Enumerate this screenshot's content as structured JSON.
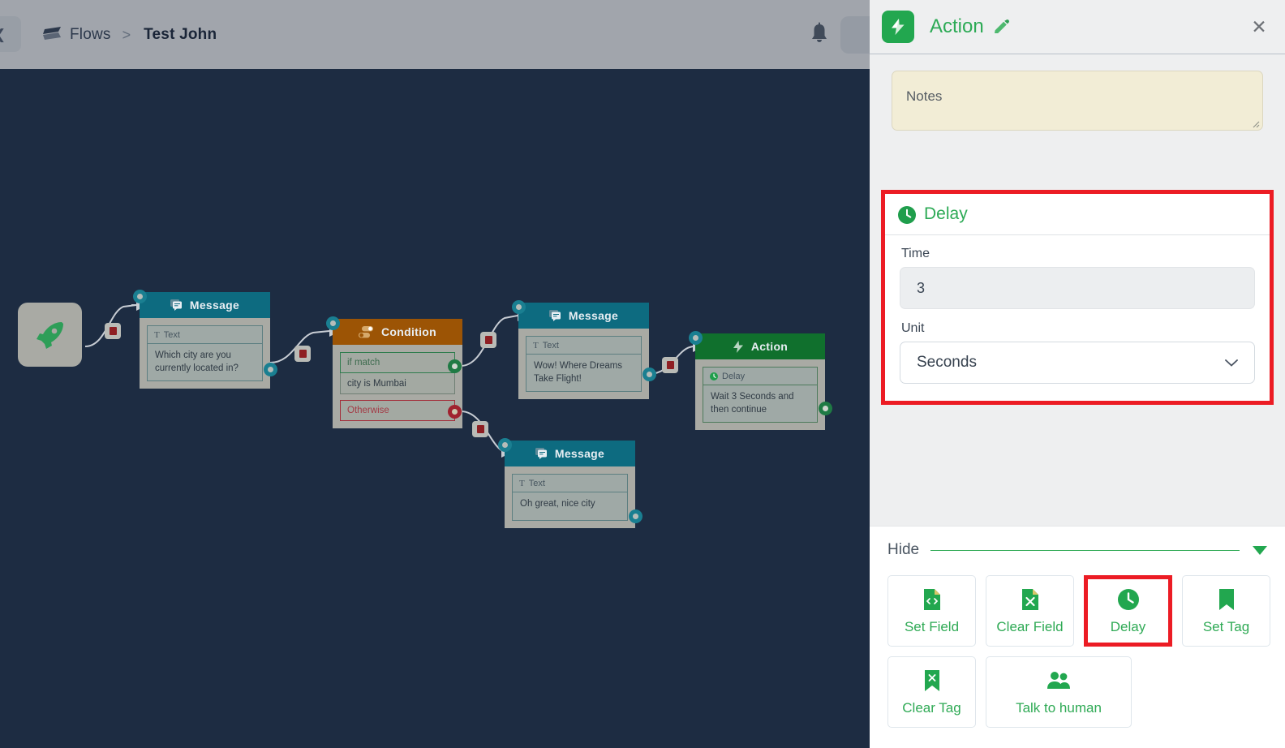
{
  "topbar": {
    "back_icon": "chevron-left-icon",
    "brand_icon": "flow-logo-icon",
    "breadcrumb_root": "Flows",
    "breadcrumb_separator": ">",
    "breadcrumb_current": "Test John",
    "bell_icon": "notification-bell-icon"
  },
  "canvas": {
    "start_icon": "rocket-icon",
    "nodes": [
      {
        "id": "msg1",
        "type": "Message",
        "title": "Message",
        "icon": "message-icon",
        "field_label": "Text",
        "field_icon": "text-icon",
        "text": "Which city are you currently located in?"
      },
      {
        "id": "cond1",
        "type": "Condition",
        "title": "Condition",
        "icon": "toggle-icon",
        "match_label": "if match",
        "match_value": "city is Mumbai",
        "otherwise_label": "Otherwise"
      },
      {
        "id": "msg2",
        "type": "Message",
        "title": "Message",
        "icon": "message-icon",
        "field_label": "Text",
        "field_icon": "text-icon",
        "text": "Wow! Where Dreams Take Flight!"
      },
      {
        "id": "msg3",
        "type": "Message",
        "title": "Message",
        "icon": "message-icon",
        "field_label": "Text",
        "field_icon": "text-icon",
        "text": "Oh great, nice city"
      },
      {
        "id": "act1",
        "type": "Action",
        "title": "Action",
        "icon": "bolt-icon",
        "field_label": "Delay",
        "field_icon": "clock-icon",
        "text": "Wait 3 Seconds and then continue"
      }
    ],
    "delete_icon": "trash-icon"
  },
  "panel": {
    "icon": "bolt-icon",
    "title": "Action",
    "edit_icon": "pencil-icon",
    "close_icon": "close-icon",
    "notes_placeholder": "Notes",
    "notes_value": "",
    "resize_icon": "resize-grip-icon",
    "delay": {
      "icon": "clock-icon",
      "title": "Delay",
      "time_label": "Time",
      "time_value": "3",
      "unit_label": "Unit",
      "unit_value": "Seconds",
      "unit_chevron": "chevron-down-icon",
      "highlight_color": "#ec1c24"
    },
    "picker": {
      "hide_label": "Hide",
      "caret_icon": "caret-down-icon",
      "buttons": [
        {
          "label": "Set Field",
          "icon": "file-code-icon",
          "selected": false
        },
        {
          "label": "Clear Field",
          "icon": "file-x-icon",
          "selected": false
        },
        {
          "label": "Delay",
          "icon": "clock-icon",
          "selected": true
        },
        {
          "label": "Set Tag",
          "icon": "bookmark-icon",
          "selected": false
        },
        {
          "label": "Clear Tag",
          "icon": "bookmark-x-icon",
          "selected": false
        },
        {
          "label": "Talk to human",
          "icon": "people-icon",
          "selected": false
        }
      ]
    }
  },
  "colors": {
    "brand_green": "#22a74f",
    "highlight_red": "#ec1c24",
    "canvas_bg": "#1d2c42",
    "message_header": "#0d6b80",
    "condition_header": "#9c5405",
    "action_header": "#10702d",
    "notes_bg": "#f2edd6"
  }
}
